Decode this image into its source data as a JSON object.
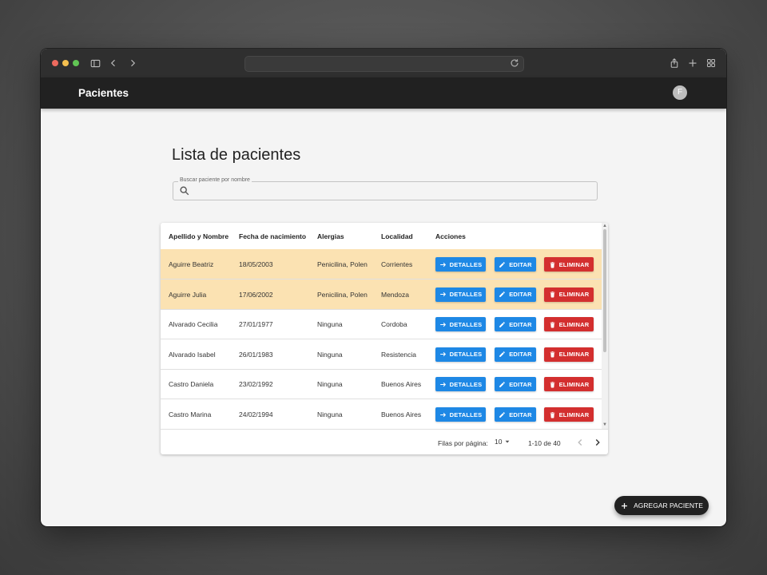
{
  "appbar": {
    "title": "Pacientes",
    "avatar_initial": "F"
  },
  "page": {
    "title": "Lista de pacientes"
  },
  "search": {
    "label": "Buscar paciente por nombre",
    "value": "",
    "placeholder": ""
  },
  "table": {
    "columns": [
      "Apellido y Nombre",
      "Fecha de nacimiento",
      "Alergias",
      "Localidad",
      "Acciones"
    ],
    "rows": [
      {
        "name": "Aguirre Beatriz",
        "birth": "18/05/2003",
        "allergies": "Penicilina, Polen",
        "city": "Corrientes"
      },
      {
        "name": "Aguirre Julia",
        "birth": "17/06/2002",
        "allergies": "Penicilina, Polen",
        "city": "Mendoza"
      },
      {
        "name": "Alvarado Cecilia",
        "birth": "27/01/1977",
        "allergies": "Ninguna",
        "city": "Cordoba"
      },
      {
        "name": "Alvarado Isabel",
        "birth": "26/01/1983",
        "allergies": "Ninguna",
        "city": "Resistencia"
      },
      {
        "name": "Castro Daniela",
        "birth": "23/02/1992",
        "allergies": "Ninguna",
        "city": "Buenos Aires"
      },
      {
        "name": "Castro Marina",
        "birth": "24/02/1994",
        "allergies": "Ninguna",
        "city": "Buenos Aires"
      }
    ],
    "actions": {
      "details": "DETALLES",
      "edit": "EDITAR",
      "delete": "ELIMINAR"
    },
    "highlight_color": "#fbe2b2"
  },
  "pagination": {
    "rows_per_page_label": "Filas por página:",
    "rows_per_page": "10",
    "range": "1-10 de 40"
  },
  "fab": {
    "label": "AGREGAR PACIENTE"
  },
  "colors": {
    "primary": "#1e88e5",
    "danger": "#d32f2f",
    "appbar": "#212121"
  }
}
